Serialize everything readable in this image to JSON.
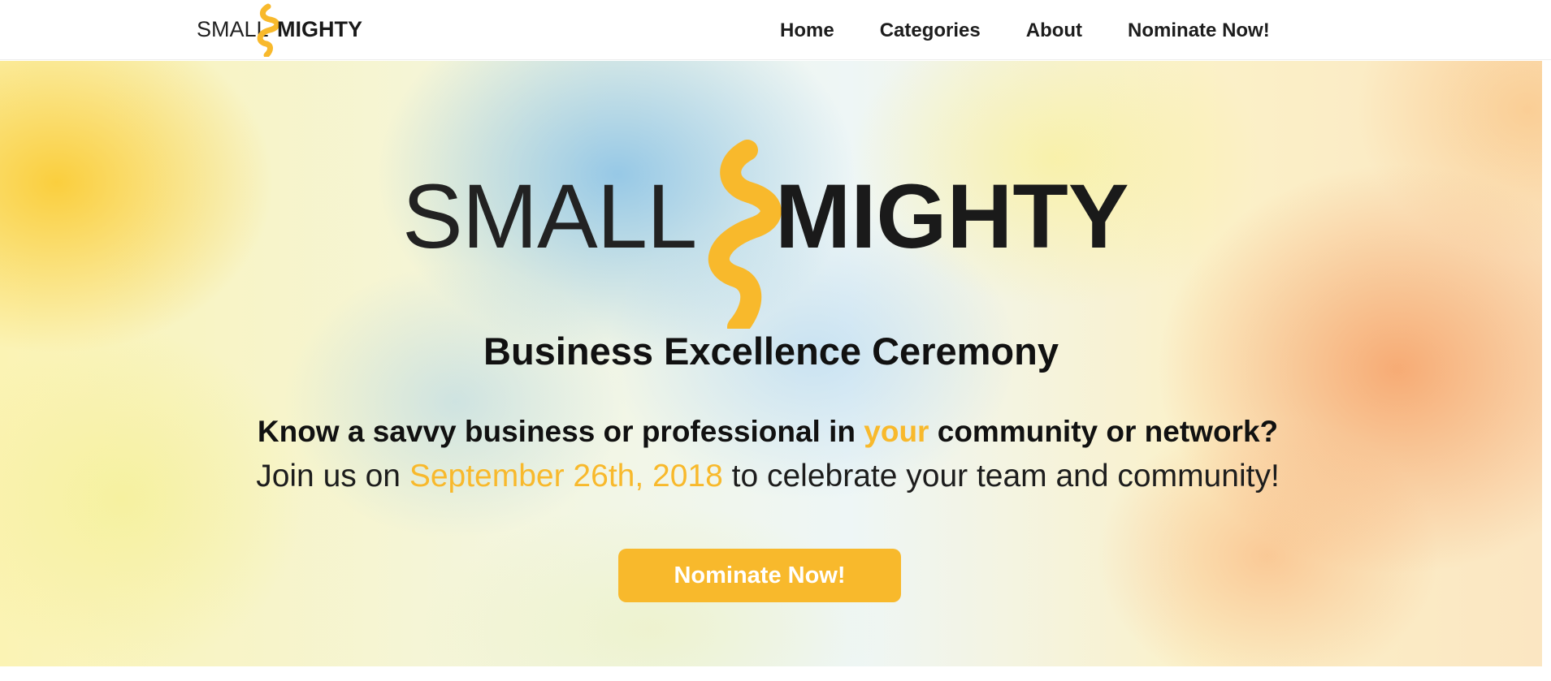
{
  "header": {
    "logo": {
      "word1": "SMALL",
      "word2": "MIGHTY",
      "accent": "#f8b92c"
    },
    "nav": [
      {
        "label": "Home"
      },
      {
        "label": "Categories"
      },
      {
        "label": "About"
      },
      {
        "label": "Nominate Now!"
      }
    ]
  },
  "hero": {
    "logo": {
      "word1": "SMALL",
      "word2": "MIGHTY"
    },
    "subtitle": "Business Excellence Ceremony",
    "question": {
      "before": "Know a savvy business or professional in ",
      "highlight": "your",
      "after": " community or network?"
    },
    "invite": {
      "before": "Join us on ",
      "date": "September 26th, 2018",
      "after": " to celebrate your team and community!"
    },
    "cta_label": "Nominate Now!"
  },
  "colors": {
    "accent": "#f8b92c",
    "text": "#111111",
    "nav_text": "#1d1d1d"
  }
}
